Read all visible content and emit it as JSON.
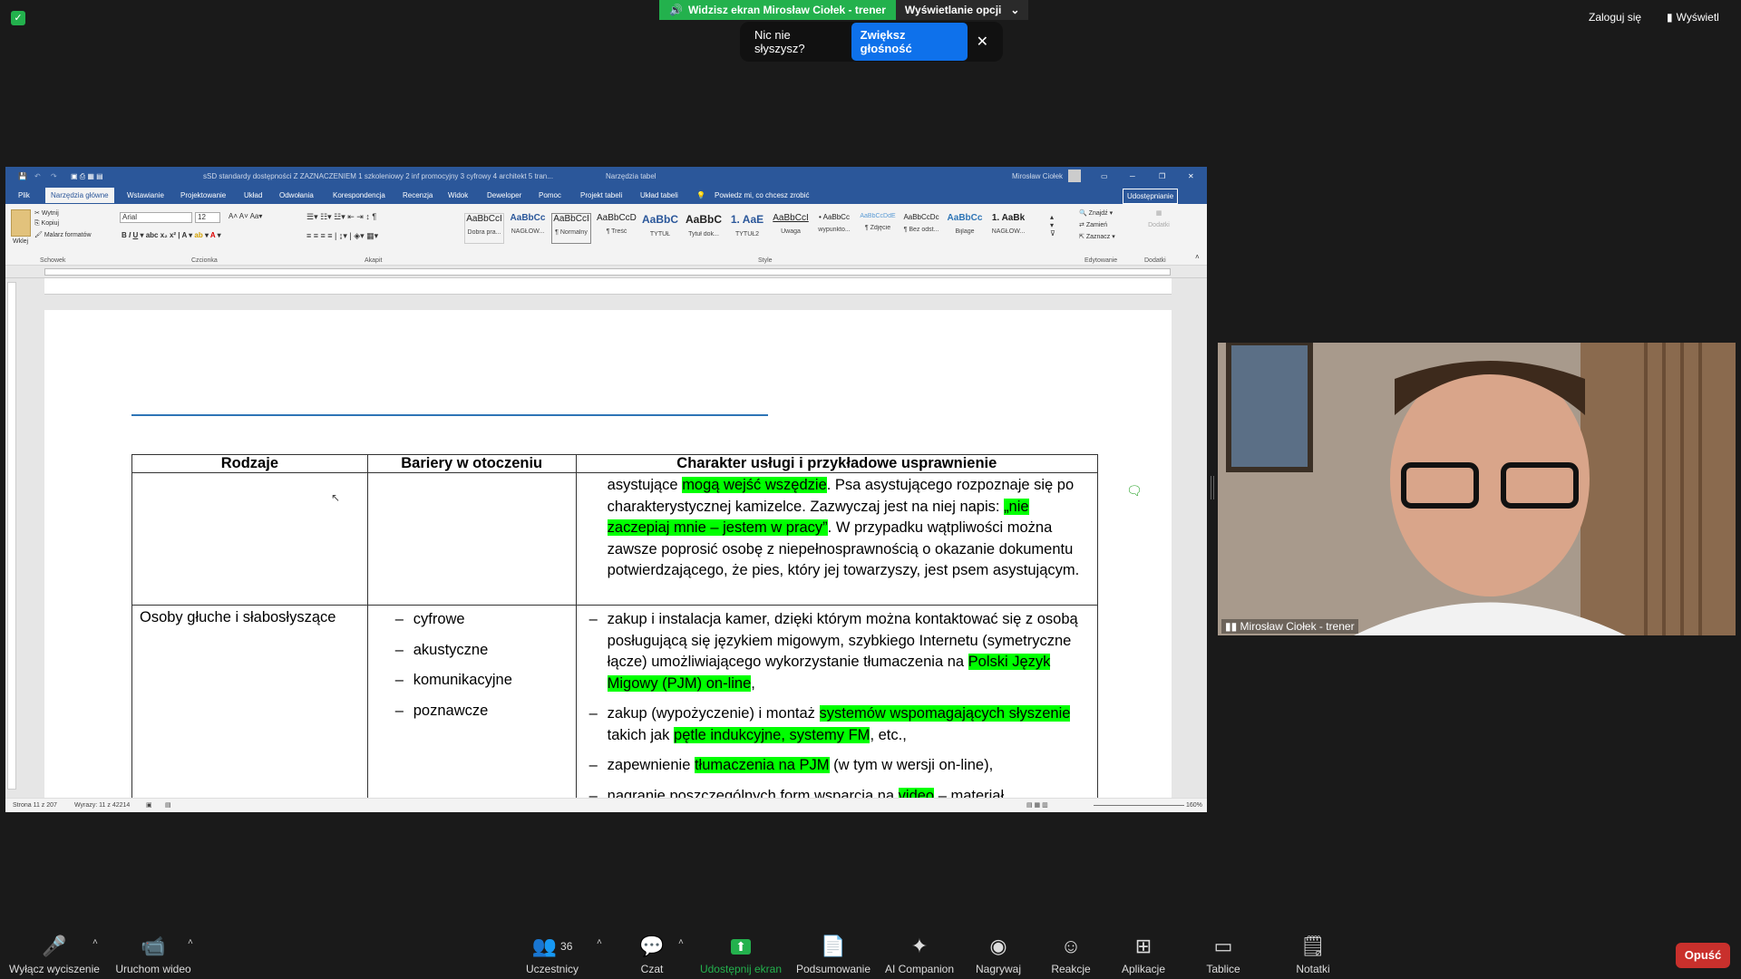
{
  "zoom": {
    "share_banner": "Widzisz ekran Mirosław Ciołek - trener",
    "view_options": "Wyświetlanie opcji",
    "audio_toast": {
      "text": "Nic nie słyszysz?",
      "button": "Zwiększ głośność"
    },
    "login": "Zaloguj się",
    "view": "Wyświetl"
  },
  "word": {
    "title": "sSD standardy dostępności Z ZAZNACZENIEM  1 szkoleniowy 2 inf promocyjny 3 cyfrowy 4 architekt 5 tran...",
    "table_tools": "Narzędzia tabel",
    "user": "Mirosław Ciołek",
    "tabs": [
      "Plik",
      "Narzędzia główne",
      "Wstawianie",
      "Projektowanie",
      "Układ",
      "Odwołania",
      "Korespondencja",
      "Recenzja",
      "Widok",
      "Deweloper",
      "Pomoc",
      "Projekt tabeli",
      "Układ tabeli"
    ],
    "tell_me": "Powiedz mi, co chcesz zrobić",
    "share": "Udostępnianie",
    "clipboard": {
      "paste": "Wklej",
      "cut": "Wytnij",
      "copy": "Kopiuj",
      "painter": "Malarz formatów",
      "group": "Schowek"
    },
    "font": {
      "name": "Arial",
      "size": "12",
      "group": "Czcionka"
    },
    "paragraph_group": "Akapit",
    "styles": [
      {
        "preview": "AaBbCcI",
        "label": "Dobra pra..."
      },
      {
        "preview": "AaBbCc",
        "label": "NAGŁÓW..."
      },
      {
        "preview": "AaBbCcI",
        "label": "¶ Normalny"
      },
      {
        "preview": "AaBbCcDi",
        "label": "¶ Treść"
      },
      {
        "preview": "AaBbC",
        "label": "TYTUŁ"
      },
      {
        "preview": "AaBbC",
        "label": "Tytuł dok..."
      },
      {
        "preview": "1. AaE",
        "label": "TYTUŁ2"
      },
      {
        "preview": "AaBbCcI",
        "label": "Uwaga"
      },
      {
        "preview": "• AaBbCc",
        "label": "wypunkto..."
      },
      {
        "preview": "AaBbCcDdE",
        "label": "¶ Zdjęcie"
      },
      {
        "preview": "AaBbCcDc",
        "label": "¶ Bez odst..."
      },
      {
        "preview": "AaBbCc",
        "label": "Bijlage"
      },
      {
        "preview": "1. AaBk",
        "label": "NAGŁÓW..."
      }
    ],
    "styles_group": "Style",
    "editing": {
      "find": "Znajdź",
      "replace": "Zamień",
      "select": "Zaznacz",
      "group": "Edytowanie"
    },
    "addins": {
      "label": "Dodatki",
      "group": "Dodatki"
    },
    "status": {
      "page": "Strona 11 z 207",
      "words": "Wyrazy: 11 z 42214",
      "zoom": "160%"
    },
    "table": {
      "headers": [
        "Rodzaje",
        "Bariery w otoczeniu",
        "Charakter usługi i przykładowe usprawnienie"
      ],
      "row1": {
        "p1_a": "asystujące ",
        "p1_hl": "mogą wejść wszędzie",
        "p1_b": ". Psa asystującego rozpoznaje się po charakterystycznej kamizelce. Zazwyczaj jest na niej napis: ",
        "p1_hl2": "„nie zaczepiaj mnie – jestem w pracy”",
        "p1_c": ". W przypadku wątpliwości można zawsze poprosić osobę z niepełnosprawnością o okazanie dokumentu potwierdzającego, że pies, który jej towarzyszy, jest psem asystującym."
      },
      "row2": {
        "type": "Osoby głuche i słabosłyszące",
        "barriers": [
          "cyfrowe",
          "akustyczne",
          "komunikacyjne",
          "poznawcze"
        ],
        "i1_a": "zakup i instalacja kamer, dzięki którym można kontaktować się z osobą posługującą się językiem migowym, szybkiego Internetu (symetryczne łącze) umożliwiającego wykorzystanie tłumaczenia na ",
        "i1_hl": "Polski Język Migowy (PJM) on-line",
        "i1_b": ",",
        "i2_a": "zakup (wypożyczenie) i montaż ",
        "i2_hl": "systemów wspomagających słyszenie",
        "i2_b": " takich jak ",
        "i2_hl2": "pętle indukcyjne, systemy FM",
        "i2_c": ", etc.,",
        "i3_a": "zapewnienie ",
        "i3_hl": "tłumaczenia na PJM",
        "i3_b": " (w tym w wersji on-line),",
        "i4_a": "nagranie poszczególnych form wsparcia na ",
        "i4_hl": "video",
        "i4_b": " – materiał"
      }
    }
  },
  "video": {
    "name": "Mirosław Ciołek - trener"
  },
  "toolbar": {
    "mute": "Wyłącz wyciszenie",
    "video": "Uruchom wideo",
    "participants": "Uczestnicy",
    "participants_count": "36",
    "chat": "Czat",
    "share": "Udostępnij ekran",
    "summary": "Podsumowanie",
    "companion": "AI Companion",
    "record": "Nagrywaj",
    "reactions": "Reakcje",
    "apps": "Aplikacje",
    "whiteboards": "Tablice",
    "notes": "Notatki",
    "leave": "Opuść"
  },
  "colors": {
    "word_blue": "#2b579a",
    "highlight": "#00ff00",
    "zoom_green": "#23b14d",
    "leave_red": "#c9302c",
    "share_blue": "#0e71eb"
  }
}
